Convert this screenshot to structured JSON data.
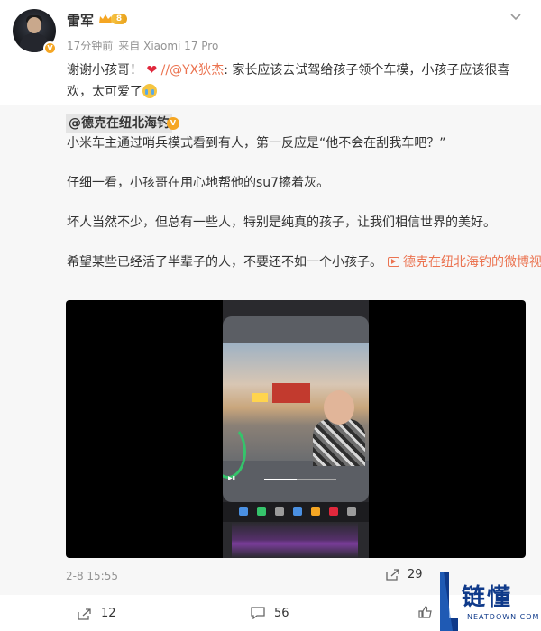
{
  "header": {
    "username": "雷军",
    "level": "8",
    "time_ago": "17分钟前",
    "source": "来自 Xiaomi 17 Pro"
  },
  "post": {
    "text_before": "谢谢小孩哥！",
    "separator": "//",
    "mention": "@YX狄杰",
    "text_after": ": 家长应该去试驾给孩子领个车模，小孩子应该很喜欢，太可爱了"
  },
  "repost": {
    "author": "@德克在纽北海钓",
    "paragraphs": [
      "小米车主通过哨兵模式看到有人，第一反应是“他不会在刮我车吧？”",
      "仔细一看，小孩哥在用心地帮他的su7擦着灰。",
      "坏人当然不少，但总有一些人，特别是纯真的孩子，让我们相信世界的美好。",
      "希望某些已经活了半辈子的人，不要还不如一个小孩子。"
    ],
    "video_link": "德克在纽北海钓的微博视频",
    "time": "2-8 15:55",
    "repost_count": "29",
    "video_progress": 0.45
  },
  "footer": {
    "forward_count": "12",
    "comment_count": "56"
  },
  "watermark": {
    "cn": "链懂",
    "en": "NEATDOWN.COM"
  },
  "colors": {
    "link": "#eb7350",
    "heart": "#e0283c",
    "meta": "#939393",
    "repost_bg": "#f7f7f7"
  }
}
